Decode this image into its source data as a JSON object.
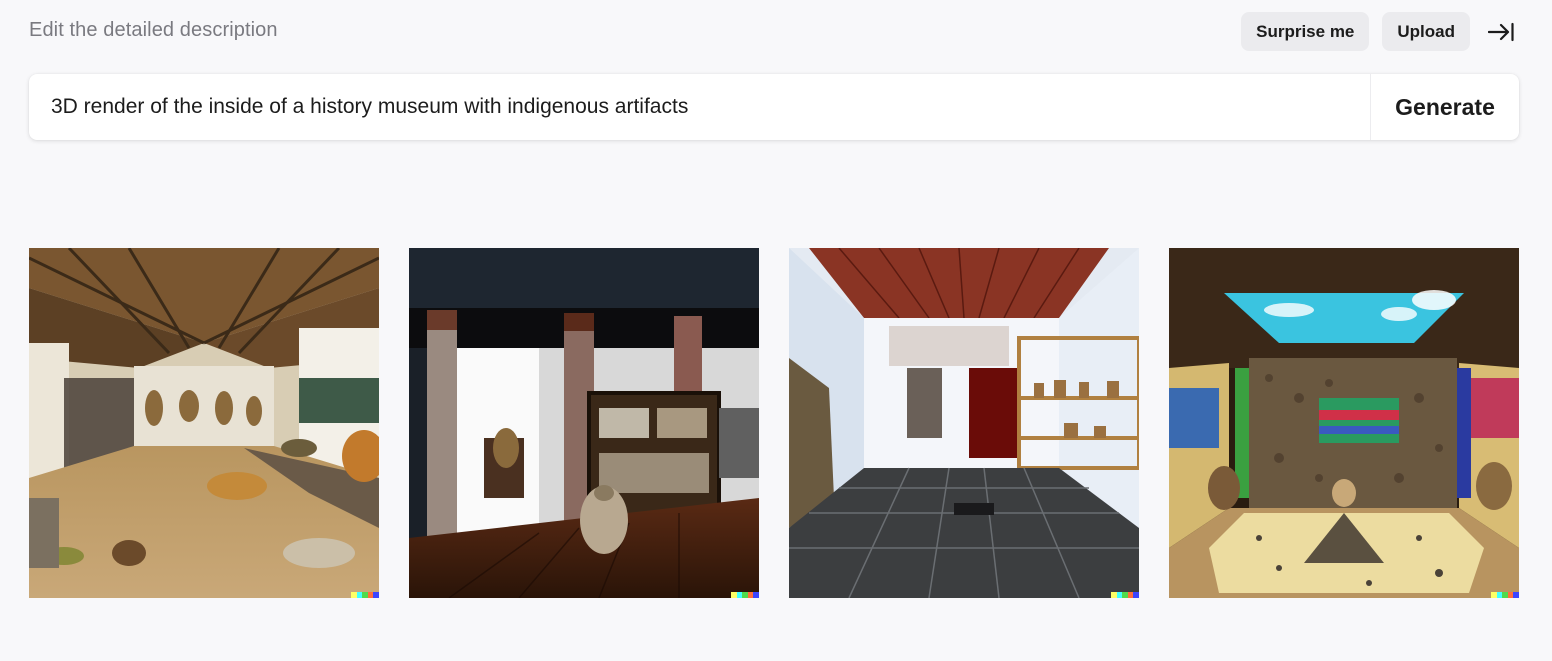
{
  "header": {
    "hint": "Edit the detailed description",
    "surprise_label": "Surprise me",
    "upload_label": "Upload"
  },
  "prompt": {
    "value": "3D render of the inside of a history museum with indigenous artifacts",
    "generate_label": "Generate"
  },
  "images": [
    {
      "name": "museum-image-1"
    },
    {
      "name": "museum-image-2"
    },
    {
      "name": "museum-image-3"
    },
    {
      "name": "museum-image-4"
    }
  ],
  "colors": {
    "background": "#f8f8fa",
    "pill": "#ebebee",
    "signature": [
      "#ffff66",
      "#42ffff",
      "#51da4c",
      "#ff6e3c",
      "#3c46ff"
    ]
  }
}
